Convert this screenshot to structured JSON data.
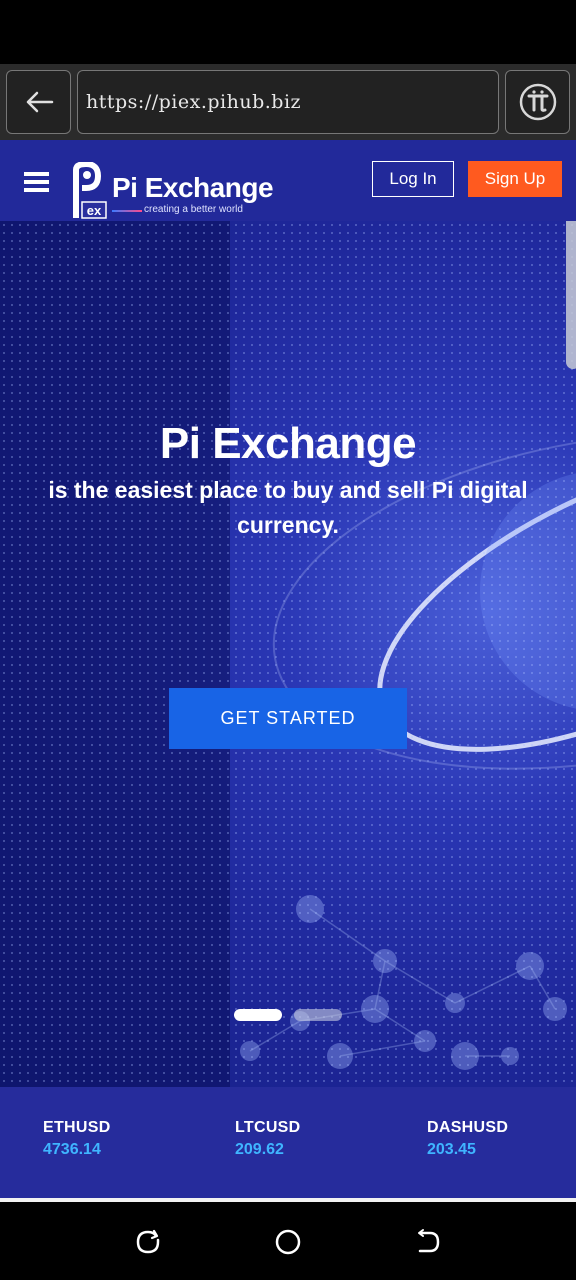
{
  "browser": {
    "url": "https://piex.pihub.biz"
  },
  "header": {
    "brand_name": "Pi Exchange",
    "logo_mark_text": "ex",
    "tagline": "creating a better world",
    "login_label": "Log In",
    "signup_label": "Sign Up"
  },
  "hero": {
    "title": "Pi Exchange",
    "subtitle": "is the easiest place to buy and sell Pi digital currency.",
    "cta_label": "GET STARTED",
    "slide_count": 2,
    "active_slide": 1
  },
  "ticker": [
    {
      "symbol": "ETHUSD",
      "value": "4736.14"
    },
    {
      "symbol": "LTCUSD",
      "value": "209.62"
    },
    {
      "symbol": "DASHUSD",
      "value": "203.45"
    }
  ],
  "colors": {
    "header_bg": "#22299a",
    "signup_bg": "#ff5a1f",
    "cta_bg": "#1864e6",
    "ticker_value": "#3fb5ff"
  }
}
